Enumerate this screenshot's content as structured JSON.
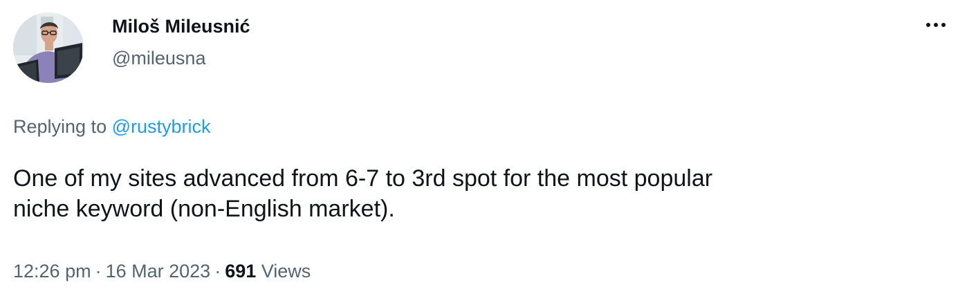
{
  "author": {
    "display_name": "Miloš Mileusnić",
    "handle": "@mileusna"
  },
  "reply": {
    "prefix": "Replying to ",
    "to_handle": "@rustybrick"
  },
  "tweet": {
    "text": "One of my sites advanced from 6-7 to 3rd spot for the most popular\nniche keyword (non-English market)."
  },
  "meta": {
    "time": "12:26 pm",
    "separator": "·",
    "date": "16 Mar 2023",
    "views_count": "691",
    "views_label": " Views"
  },
  "icons": {
    "more": "more-horizontal-icon",
    "avatar": "user-avatar"
  },
  "colors": {
    "primary_text": "#0f1419",
    "secondary_text": "#536471",
    "link": "#1d9bf0",
    "background": "#ffffff"
  }
}
